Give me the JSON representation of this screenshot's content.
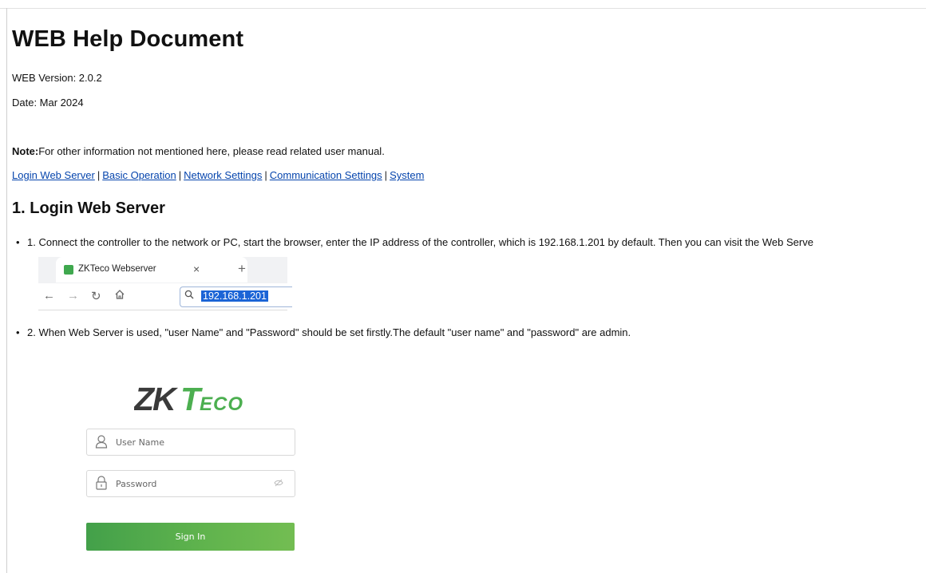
{
  "title": "WEB Help Document",
  "version_line": "WEB Version: 2.0.2",
  "date_line": "Date: Mar 2024",
  "note": {
    "label": "Note:",
    "text": "For other information not mentioned here, please read related user manual."
  },
  "nav_links": [
    "Login Web Server",
    "Basic Operation",
    "Network Settings",
    "Communication Settings",
    "System"
  ],
  "nav_separator": "|",
  "section1": {
    "heading": "1. Login Web Server",
    "step1": "1. Connect the controller to the network or PC, start the browser, enter the IP address of the controller, which is 192.168.1.201 by default. Then you can visit the Web Serve",
    "step2": "2. When Web Server is used, \"user Name\" and \"Password\" should be set firstly.The default \"user name\" and \"password\" are admin."
  },
  "browser": {
    "tab_title": "ZKTeco Webserver",
    "tab_close": "×",
    "new_tab": "+",
    "address": "192.168.1.201",
    "icons": [
      "back-arrow-icon",
      "forward-arrow-icon",
      "reload-icon",
      "home-icon",
      "search-icon"
    ]
  },
  "login": {
    "logo_text": "ZKTeco",
    "username_placeholder": "User Name",
    "password_placeholder": "Password",
    "signin_label": "Sign In",
    "accent_color": "#4caf50"
  }
}
